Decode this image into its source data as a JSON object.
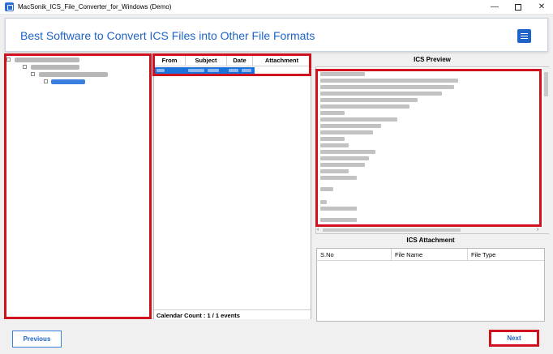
{
  "window": {
    "title": "MacSonik_ICS_File_Converter_for_Windows (Demo)",
    "minimize_label": "—",
    "close_label": "✕"
  },
  "header": {
    "headline": "Best Software to Convert ICS Files into Other File Formats"
  },
  "grid": {
    "columns": [
      "From",
      "Subject",
      "Date",
      "Attachment"
    ],
    "footer": "Calendar Count : 1 / 1 events"
  },
  "preview": {
    "title": "ICS Preview"
  },
  "attachments": {
    "title": "ICS Attachment",
    "columns": [
      "S.No",
      "File Name",
      "File Type"
    ]
  },
  "buttons": {
    "previous": "Previous",
    "next": "Next"
  },
  "colors": {
    "accent": "#1e63c8",
    "highlight": "#d0121f",
    "selection": "#1d73d9"
  }
}
